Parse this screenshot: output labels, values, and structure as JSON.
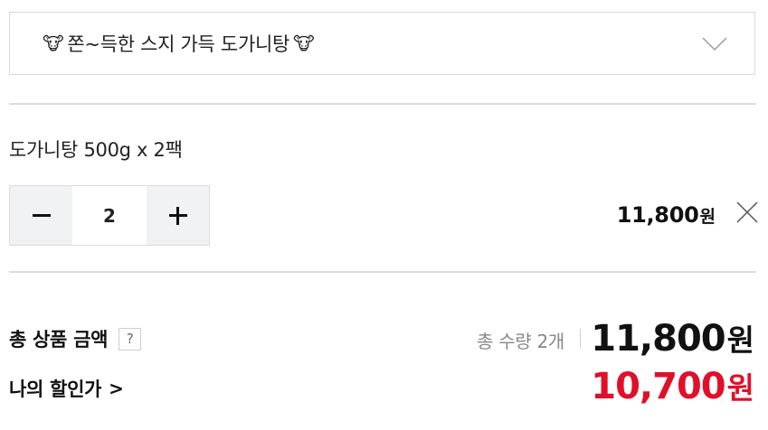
{
  "option_select": {
    "emoji": "🐮",
    "selected_label": "쫀~득한 스지 가득 도가니탕",
    "icon": "chevron-down-icon"
  },
  "item": {
    "name": "도가니탕 500g x 2팩",
    "quantity": "2",
    "price": "11,800",
    "currency": "원",
    "remove_icon": "close-icon"
  },
  "summary": {
    "total_label": "총 상품 금액",
    "help_label": "?",
    "quantity_text": "총 수량 2개",
    "total_price": "11,800",
    "currency": "원",
    "my_discount_label": "나의 할인가",
    "my_discount_arrow": ">",
    "discount_price": "10,700"
  },
  "colors": {
    "discount": "#e0102a",
    "border": "#d9d9d9",
    "stepper_bg": "#f1f2f4"
  }
}
